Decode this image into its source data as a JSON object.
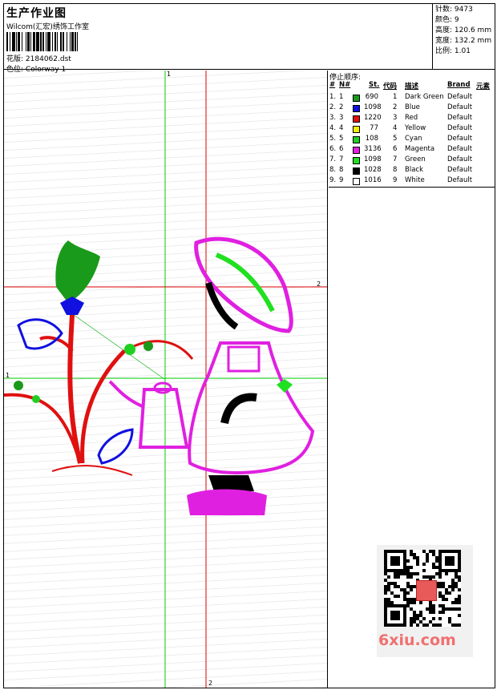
{
  "header": {
    "title": "生产作业图",
    "studio": "Wilcom(汇宏)绣饰工作室",
    "pattern_label": "花版:",
    "pattern_value": "2184062.dst",
    "colorway_label": "色位:",
    "colorway_value": "Colorway 1"
  },
  "stats": [
    {
      "label": "针数:",
      "value": "9473"
    },
    {
      "label": "颜色:",
      "value": "9"
    },
    {
      "label": "高度:",
      "value": "120.6 mm"
    },
    {
      "label": "宽度:",
      "value": "132.2 mm"
    },
    {
      "label": "比例:",
      "value": "1.01"
    }
  ],
  "stop_sequence": {
    "title": "停止顺序:",
    "columns": [
      "#",
      "N#",
      "St.",
      "代码",
      "描述",
      "Brand",
      "元素"
    ],
    "rows": [
      {
        "idx": "1.",
        "n": "1",
        "color": "#1a9a1a",
        "st": "690",
        "code": "1",
        "desc": "Dark Green",
        "brand": "Default"
      },
      {
        "idx": "2.",
        "n": "2",
        "color": "#1010e0",
        "st": "1098",
        "code": "2",
        "desc": "Blue",
        "brand": "Default"
      },
      {
        "idx": "3.",
        "n": "3",
        "color": "#e01010",
        "st": "1220",
        "code": "3",
        "desc": "Red",
        "brand": "Default"
      },
      {
        "idx": "4.",
        "n": "4",
        "color": "#f0f000",
        "st": "77",
        "code": "4",
        "desc": "Yellow",
        "brand": "Default"
      },
      {
        "idx": "5.",
        "n": "5",
        "color": "#20d020",
        "st": "108",
        "code": "5",
        "desc": "Cyan",
        "brand": "Default"
      },
      {
        "idx": "6.",
        "n": "6",
        "color": "#e020e0",
        "st": "3136",
        "code": "6",
        "desc": "Magenta",
        "brand": "Default"
      },
      {
        "idx": "7.",
        "n": "7",
        "color": "#20e020",
        "st": "1098",
        "code": "7",
        "desc": "Green",
        "brand": "Default"
      },
      {
        "idx": "8.",
        "n": "8",
        "color": "#000000",
        "st": "1028",
        "code": "8",
        "desc": "Black",
        "brand": "Default"
      },
      {
        "idx": "9.",
        "n": "9",
        "color": "#ffffff",
        "st": "1016",
        "code": "9",
        "desc": "White",
        "brand": "Default"
      }
    ]
  },
  "canvas": {
    "marker_top": "1",
    "marker_left": "1",
    "marker_right": "2",
    "marker_bottom": "2",
    "guide_colors": {
      "green": "#00cc00",
      "red": "#dd0000"
    }
  },
  "watermark": {
    "site": "6xiu.com"
  }
}
